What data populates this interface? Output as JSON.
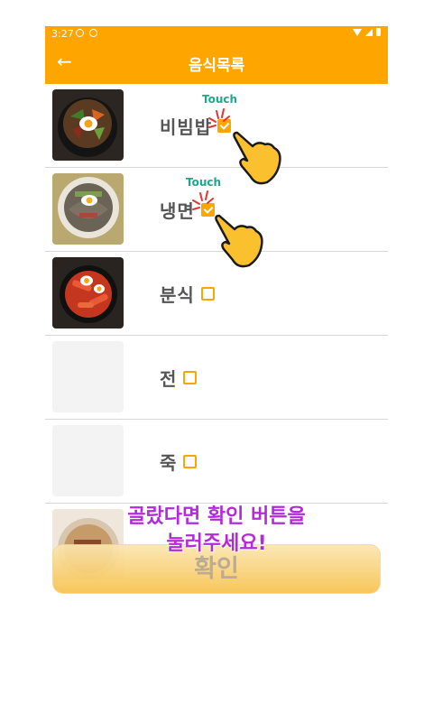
{
  "status_bar": {
    "time": "3:27"
  },
  "app_bar": {
    "back_icon": "arrow-left-icon",
    "title": "음식목록"
  },
  "foods": [
    {
      "name": "비빔밥",
      "checked": true,
      "thumb": "bibimbap"
    },
    {
      "name": "냉면",
      "checked": true,
      "thumb": "naengmyeon"
    },
    {
      "name": "분식",
      "checked": false,
      "thumb": "tteokbokki"
    },
    {
      "name": "전",
      "checked": false,
      "thumb": ""
    },
    {
      "name": "죽",
      "checked": false,
      "thumb": ""
    }
  ],
  "touch_hint": {
    "label": "Touch"
  },
  "instruction": {
    "line1": "골랐다면 확인 버튼을",
    "line2": "눌러주세요!"
  },
  "confirm_button": {
    "label": "확인"
  },
  "colors": {
    "accent": "#ffa500",
    "hint_text": "#b32ad8",
    "touch_text": "#1ba98c"
  }
}
